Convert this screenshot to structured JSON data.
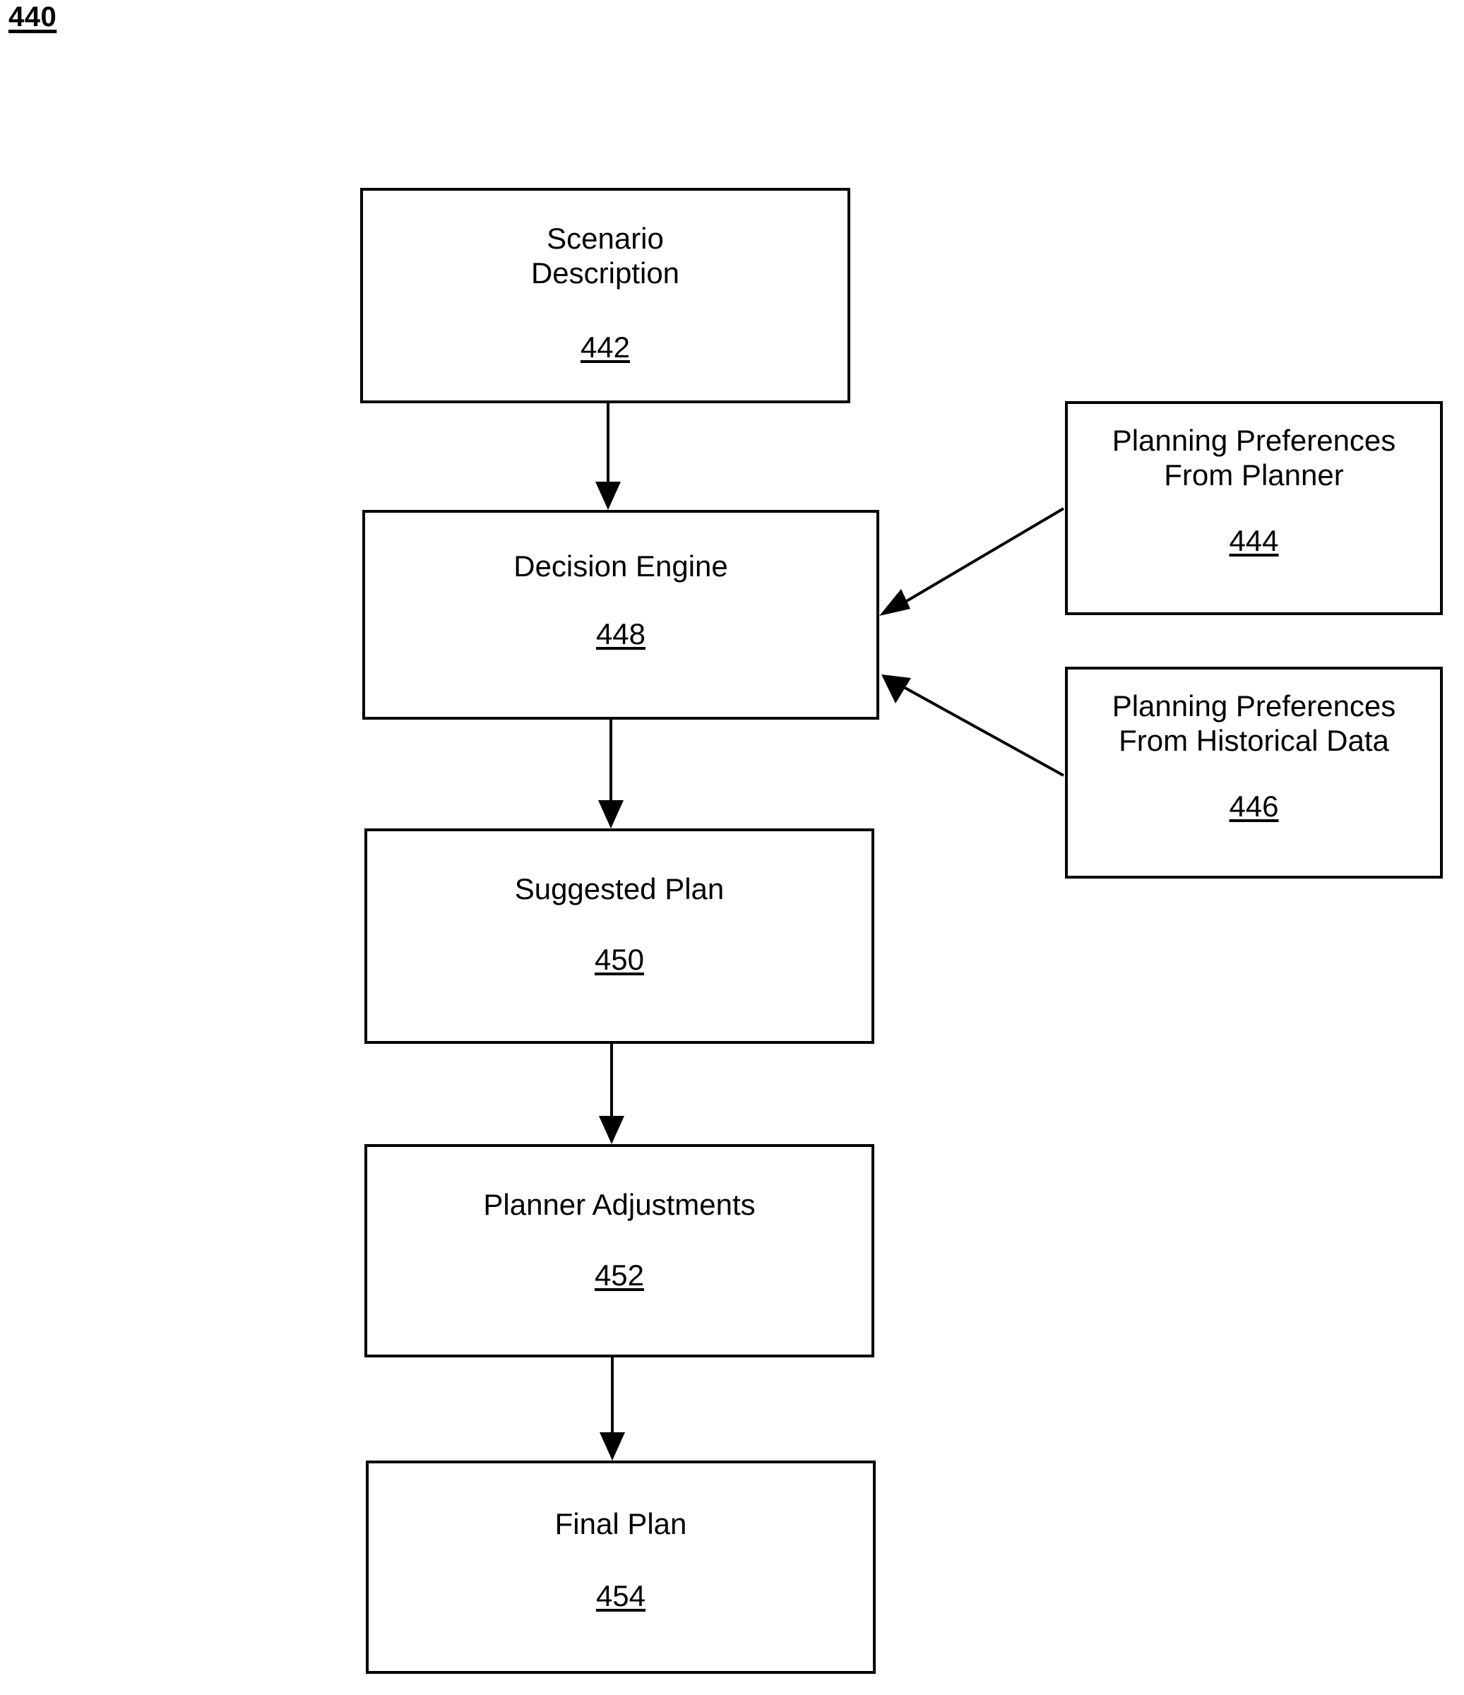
{
  "figure": {
    "number": "440"
  },
  "nodes": [
    {
      "id": "scenario-description",
      "label": "Scenario\nDescription",
      "ref": "442"
    },
    {
      "id": "decision-engine",
      "label": "Decision Engine",
      "ref": "448"
    },
    {
      "id": "planning-preferences-planner",
      "label": "Planning Preferences\nFrom Planner",
      "ref": "444"
    },
    {
      "id": "planning-preferences-historical",
      "label": "Planning Preferences\nFrom Historical Data",
      "ref": "446"
    },
    {
      "id": "suggested-plan",
      "label": "Suggested Plan",
      "ref": "450"
    },
    {
      "id": "planner-adjustments",
      "label": "Planner Adjustments",
      "ref": "452"
    },
    {
      "id": "final-plan",
      "label": "Final Plan",
      "ref": "454"
    }
  ],
  "connectors": [
    {
      "from": "scenario-description",
      "to": "decision-engine",
      "kind": "vertical-arrow"
    },
    {
      "from": "planning-preferences-planner",
      "to": "decision-engine",
      "kind": "diagonal-arrow"
    },
    {
      "from": "planning-preferences-historical",
      "to": "decision-engine",
      "kind": "diagonal-arrow"
    },
    {
      "from": "decision-engine",
      "to": "suggested-plan",
      "kind": "vertical-arrow"
    },
    {
      "from": "suggested-plan",
      "to": "planner-adjustments",
      "kind": "vertical-arrow"
    },
    {
      "from": "planner-adjustments",
      "to": "final-plan",
      "kind": "vertical-arrow"
    }
  ],
  "colors": {
    "stroke": "#000000",
    "background": "#ffffff"
  }
}
